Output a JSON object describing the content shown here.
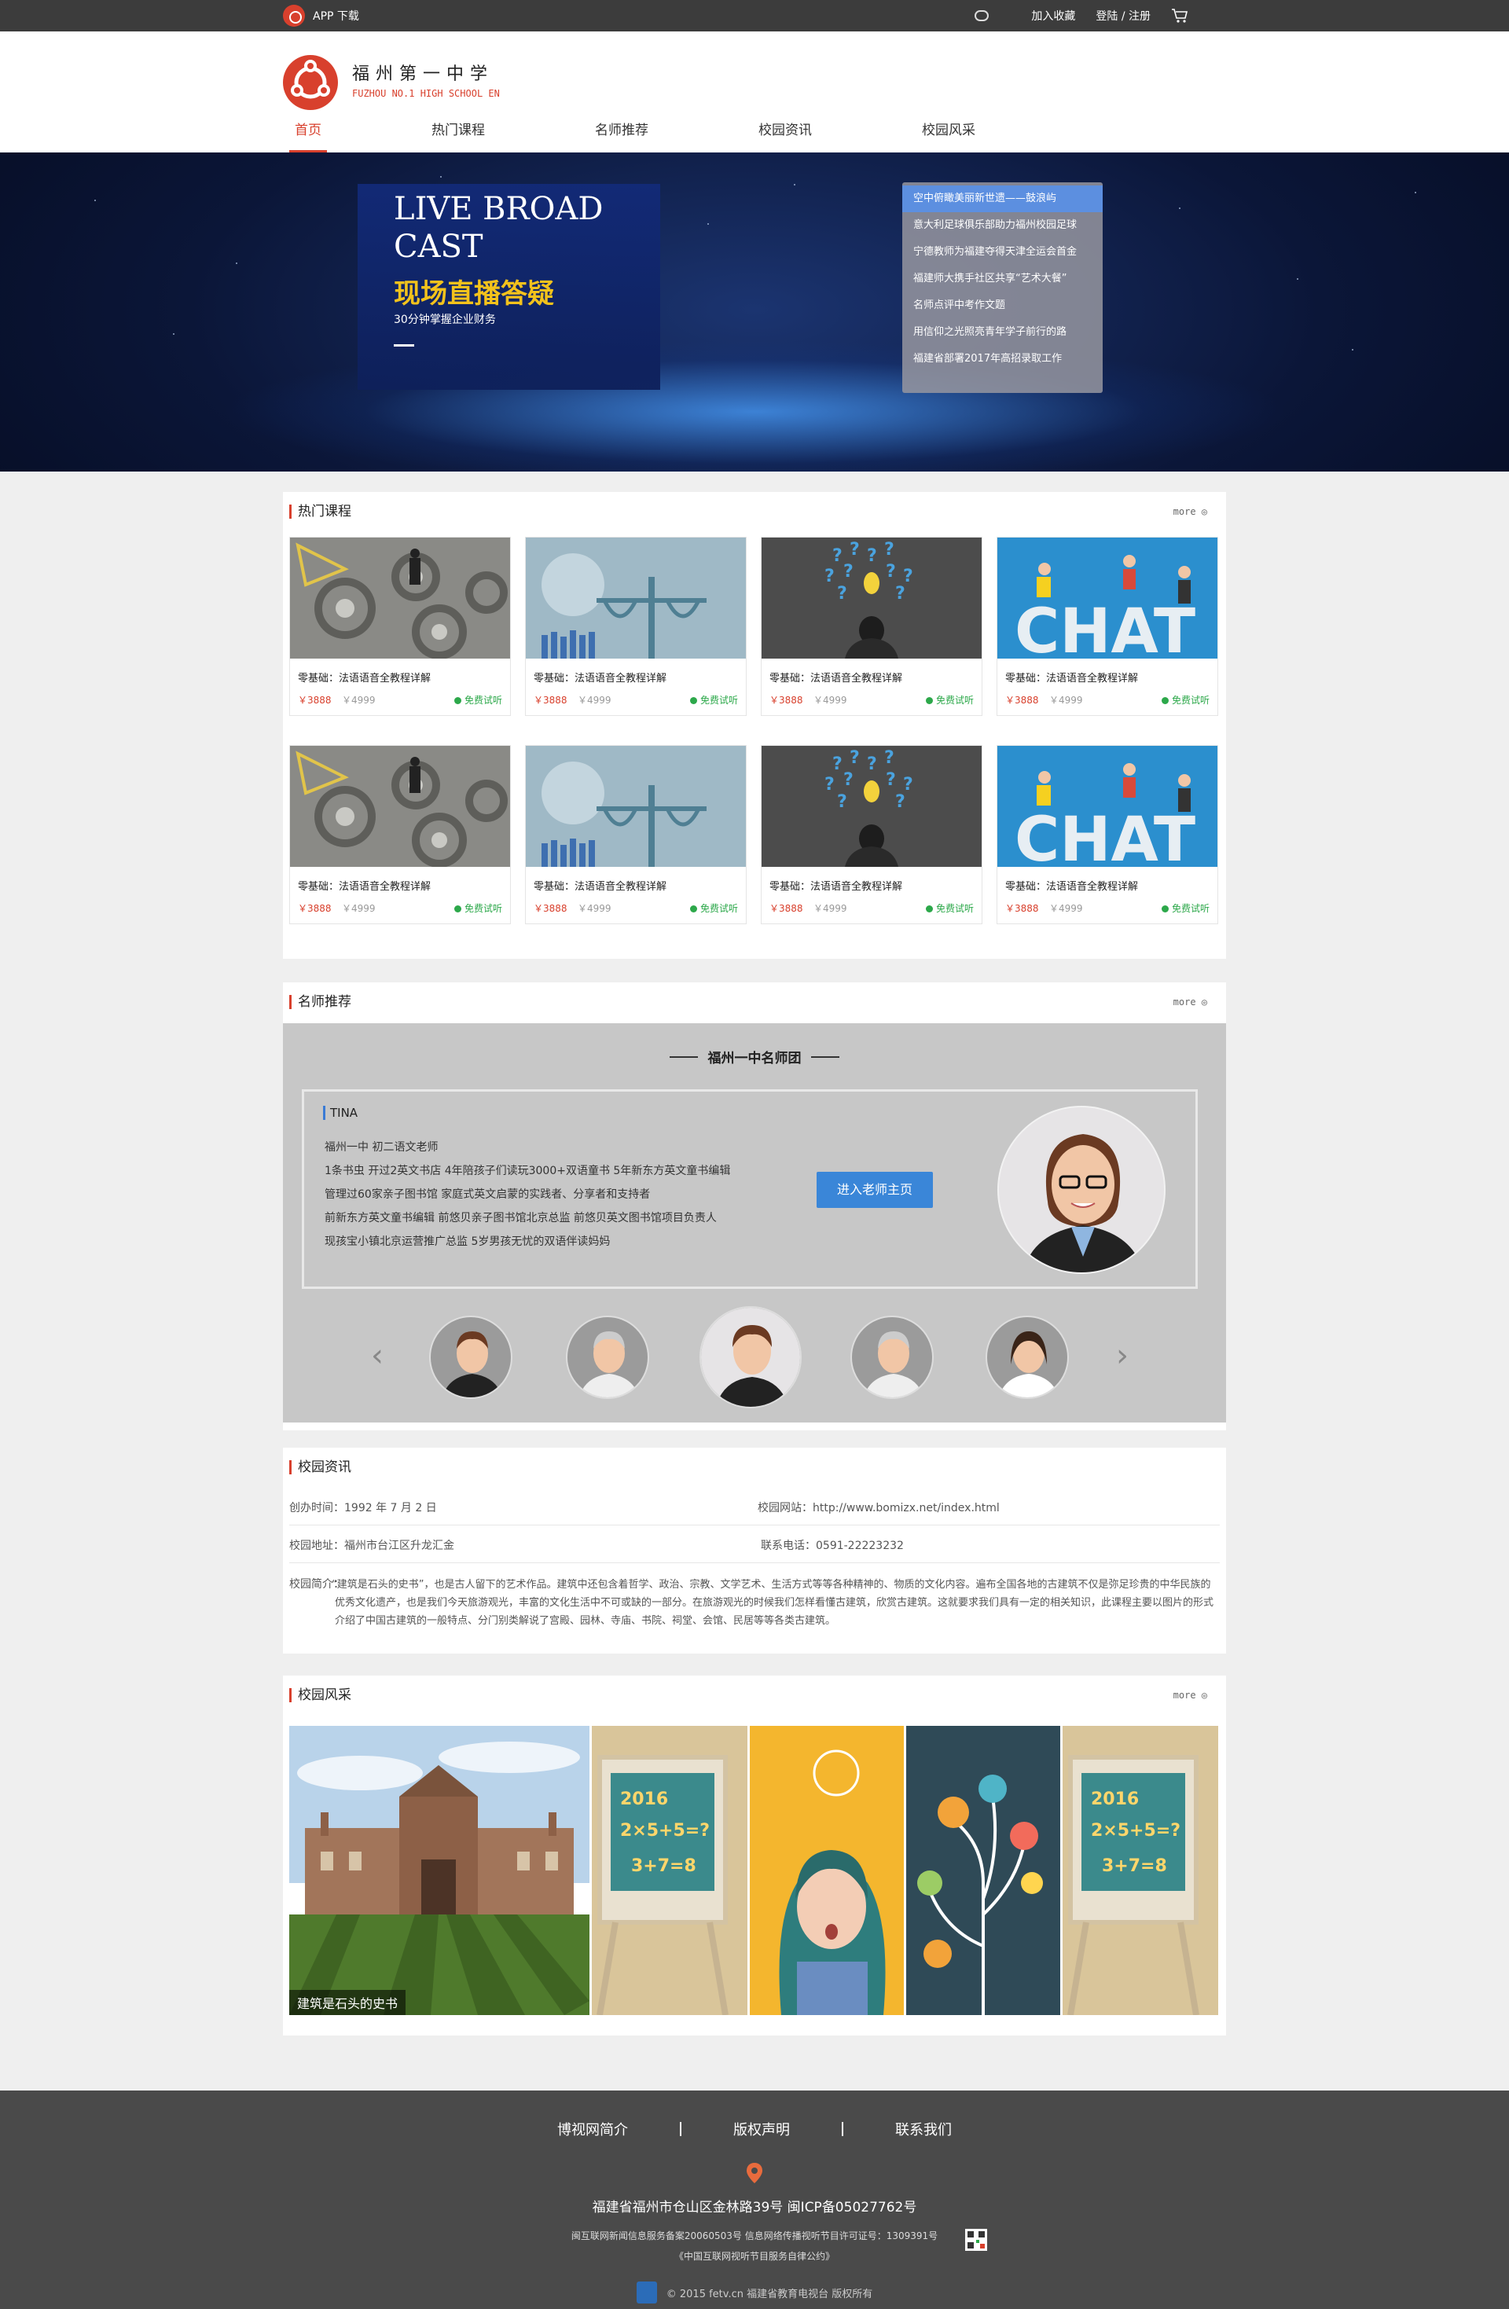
{
  "topbar": {
    "app_download": "APP 下载",
    "favorite": "加入收藏",
    "login": "登陆 / 注册"
  },
  "header": {
    "name": "福州第一中学",
    "en": "FUZHOU NO.1 HIGH SCHOOL EN",
    "nav": [
      "首页",
      "热门课程",
      "名师推荐",
      "校园资讯",
      "校园风采"
    ]
  },
  "banner": {
    "title": "LIVE BROAD CAST",
    "cn_title": "现场直播答疑",
    "subtitle": "30分钟掌握企业财务",
    "news": [
      "空中俯瞰美丽新世遗——鼓浪屿",
      "意大利足球俱乐部助力福州校园足球",
      "宁德教师为福建夺得天津全运会首金",
      "福建师大携手社区共享“艺术大餐”",
      "名师点评中考作文题",
      "用信仰之光照亮青年学子前行的路",
      "福建省部署2017年高招录取工作"
    ]
  },
  "courses": {
    "title": "热门课程",
    "more": "more",
    "items": [
      {
        "name": "零基础：法语语音全教程详解",
        "price": "￥3888",
        "old": "￥4999",
        "trial": "免费试听",
        "img": "gears"
      },
      {
        "name": "零基础：法语语音全教程详解",
        "price": "￥3888",
        "old": "￥4999",
        "trial": "免费试听",
        "img": "scale"
      },
      {
        "name": "零基础：法语语音全教程详解",
        "price": "￥3888",
        "old": "￥4999",
        "trial": "免费试听",
        "img": "questions"
      },
      {
        "name": "零基础：法语语音全教程详解",
        "price": "￥3888",
        "old": "￥4999",
        "trial": "免费试听",
        "img": "chat"
      },
      {
        "name": "零基础：法语语音全教程详解",
        "price": "￥3888",
        "old": "￥4999",
        "trial": "免费试听",
        "img": "gears"
      },
      {
        "name": "零基础：法语语音全教程详解",
        "price": "￥3888",
        "old": "￥4999",
        "trial": "免费试听",
        "img": "scale"
      },
      {
        "name": "零基础：法语语音全教程详解",
        "price": "￥3888",
        "old": "￥4999",
        "trial": "免费试听",
        "img": "questions"
      },
      {
        "name": "零基础：法语语音全教程详解",
        "price": "￥3888",
        "old": "￥4999",
        "trial": "免费试听",
        "img": "chat"
      }
    ]
  },
  "teachers": {
    "title": "名师推荐",
    "more": "more",
    "team": "福州一中名师团",
    "name": "TINA",
    "desc": [
      "福州一中  初二语文老师",
      "1条书虫  开过2英文书店  4年陪孩子们读玩3000+双语童书  5年新东方英文童书编辑",
      "管理过60家亲子图书馆  家庭式英文启蒙的实践者、分享者和支持者",
      "前新东方英文童书编辑  前悠贝亲子图书馆北京总监  前悠贝英文图书馆项目负责人",
      "现孩宝小镇北京运营推广总监  5岁男孩无忧的双语伴读妈妈"
    ],
    "button": "进入老师主页"
  },
  "campus_info": {
    "title": "校园资讯",
    "founded": "创办时间：1992 年 7 月 2 日",
    "website": "校园网站：http://www.bomizx.net/index.html",
    "address": "校园地址：福州市台江区升龙汇金",
    "phone": "联系电话：0591-22223232",
    "intro_label": "校园简介：",
    "intro": "“建筑是石头的史书”，也是古人留下的艺术作品。建筑中还包含着哲学、政治、宗教、文学艺术、生活方式等等各种精神的、物质的文化内容。遍布全国各地的古建筑不仅是弥足珍贵的中华民族的优秀文化遗产，也是我们今天旅游观光，丰富的文化生活中不可或缺的一部分。在旅游观光的时候我们怎样看懂古建筑，欣赏古建筑。这就要求我们具有一定的相关知识，此课程主要以图片的形式介绍了中国古建筑的一般特点、分门别类解说了宫殿、园林、寺庙、书院、祠堂、会馆、民居等等各类古建筑。"
  },
  "campus_style": {
    "title": "校园风采",
    "more": "more",
    "caption": "建筑是石头的史书"
  },
  "footer": {
    "links": [
      "博视网简介",
      "版权声明",
      "联系我们"
    ],
    "address": "福建省福州市仓山区金林路39号  闽ICP备05027762号",
    "license": "闽互联网新闻信息服务备案20060503号  信息网络传播视听节目许可证号：1309391号",
    "pact": "《中国互联网视听节目服务自律公约》",
    "copyright": "© 2015 fetv.cn 福建省教育电视台 版权所有"
  },
  "colors": {
    "accent": "#d8402d",
    "button": "#3a86d8",
    "trial": "#2ca84a"
  }
}
